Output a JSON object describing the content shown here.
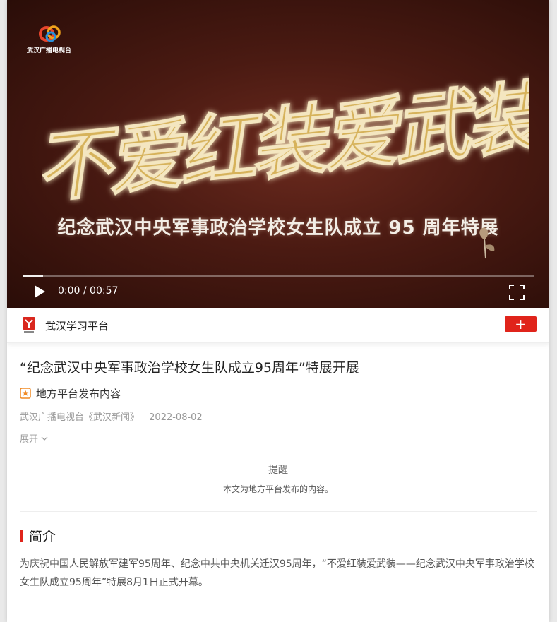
{
  "video": {
    "station_logo_text": "武汉广播电视台",
    "calligraphy_text": "不爱红装爱武装",
    "subtitle": "纪念武汉中央军事政治学校女生队成立 95 周年特展",
    "time": "0:00 / 00:57",
    "progress": 0.04
  },
  "channel": {
    "name": "武汉学习平台",
    "follow_label": "+"
  },
  "article": {
    "title": "“纪念武汉中央军事政治学校女生队成立95周年”特展开展",
    "badge": "地方平台发布内容",
    "source": "武汉广播电视台《武汉新闻》",
    "date": "2022-08-02",
    "expand": "展开"
  },
  "notice": {
    "label": "提醒",
    "body": "本文为地方平台发布的内容。"
  },
  "intro": {
    "heading": "简介",
    "text": "为庆祝中国人民解放军建军95周年、纪念中共中央机关迁汉95周年，“不爱红装爱武装——纪念武汉中央军事政治学校女生队成立95周年”特展8月1日正式开幕。"
  },
  "colors": {
    "accent": "#e0241b",
    "gold": "#d6b25a"
  }
}
